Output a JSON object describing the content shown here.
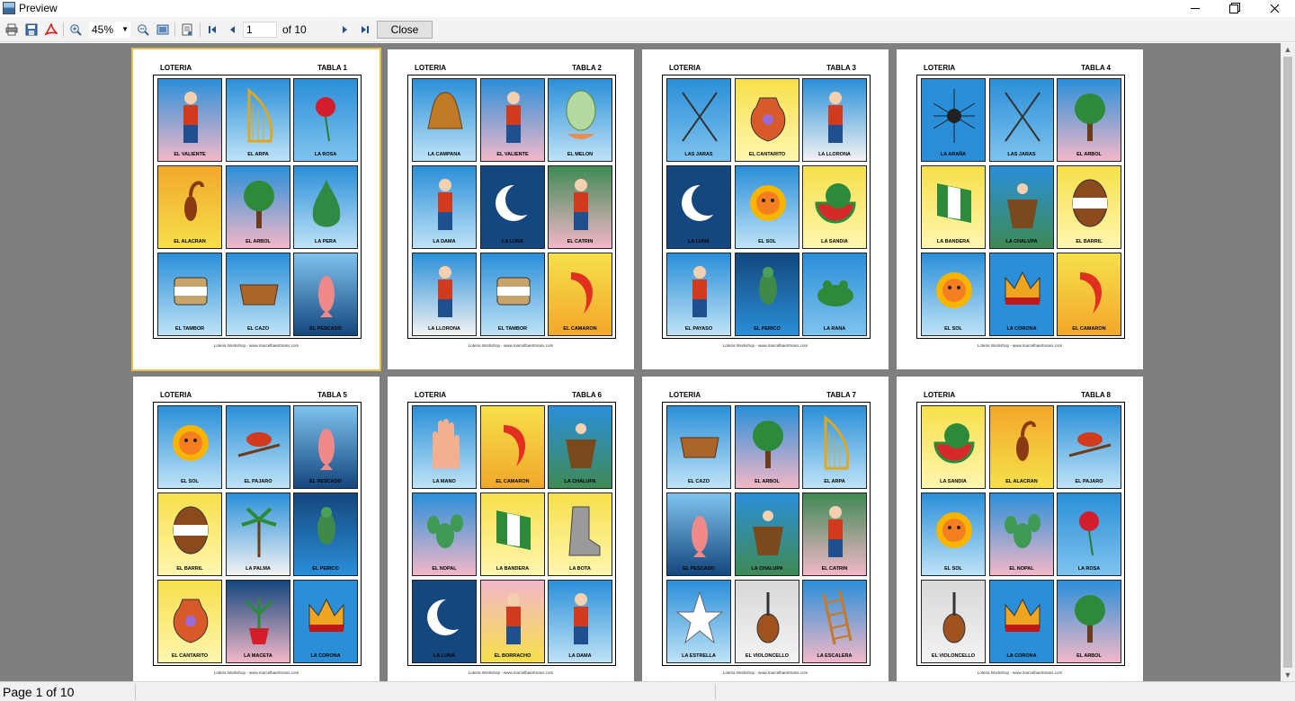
{
  "window": {
    "title": "Preview",
    "app_icon": "preview-app-icon"
  },
  "toolbar": {
    "icons": [
      "print-icon",
      "save-icon",
      "pdf-icon",
      "zoom-in-icon",
      "zoom-out-icon",
      "fit-page-icon",
      "page-setup-icon",
      "first-page-icon",
      "previous-page-icon",
      "next-page-icon",
      "last-page-icon"
    ],
    "zoom_value": "45%",
    "page_value": "1",
    "page_of": "of 10",
    "close_label": "Close"
  },
  "pages": [
    {
      "heading_left": "LOTERIA",
      "heading_right": "TABLA  1",
      "cards": [
        "EL VALIENTE",
        "EL ARPA",
        "LA ROSA",
        "EL ALACRAN",
        "EL ARBOL",
        "LA PERA",
        "EL TAMBOR",
        "EL CAZO",
        "EL PESCADO"
      ]
    },
    {
      "heading_left": "LOTERIA",
      "heading_right": "TABLA  2",
      "cards": [
        "LA CAMPANA",
        "EL VALIENTE",
        "EL MELON",
        "LA DAMA",
        "LA LUNA",
        "EL CATRIN",
        "LA LLORONA",
        "EL TAMBOR",
        "EL CAMARON"
      ]
    },
    {
      "heading_left": "LOTERIA",
      "heading_right": "TABLA  3",
      "cards": [
        "LAS JARAS",
        "EL CANTARITO",
        "LA LLORONA",
        "LA LUNA",
        "EL SOL",
        "LA SANDIA",
        "EL PAYASO",
        "EL PERICO",
        "LA RANA"
      ]
    },
    {
      "heading_left": "LOTERIA",
      "heading_right": "TABLA  4",
      "cards": [
        "LA ARAÑA",
        "LAS JARAS",
        "EL ARBOL",
        "LA BANDERA",
        "LA CHALUPA",
        "EL BARRIL",
        "EL SOL",
        "LA CORONA",
        "EL CAMARON"
      ]
    },
    {
      "heading_left": "LOTERIA",
      "heading_right": "TABLA  5",
      "cards": [
        "EL SOL",
        "EL PAJARO",
        "EL PESCADO",
        "EL BARRIL",
        "LA PALMA",
        "EL PERICO",
        "EL CANTARITO",
        "LA MACETA",
        "LA CORONA"
      ]
    },
    {
      "heading_left": "LOTERIA",
      "heading_right": "TABLA  6",
      "cards": [
        "LA MANO",
        "EL CAMARON",
        "LA CHALUPA",
        "EL NOPAL",
        "LA BANDERA",
        "LA BOTA",
        "LA LUNA",
        "EL BORRACHO",
        "LA DAMA"
      ]
    },
    {
      "heading_left": "LOTERIA",
      "heading_right": "TABLA  7",
      "cards": [
        "EL CAZO",
        "EL ARBOL",
        "EL ARPA",
        "EL PESCADO",
        "LA CHALUPA",
        "EL CATRIN",
        "LA ESTRELLA",
        "EL VIOLONCELLO",
        "LA ESCALERA"
      ]
    },
    {
      "heading_left": "LOTERIA",
      "heading_right": "TABLA  8",
      "cards": [
        "LA SANDIA",
        "EL ALACRAN",
        "EL PAJARO",
        "EL SOL",
        "EL NOPAL",
        "LA ROSA",
        "EL VIOLONCELLO",
        "LA CORONA",
        "EL ARBOL"
      ]
    }
  ],
  "footer_text": "Loteria Workshop - www.marcelbaertmans.com",
  "status": {
    "page_text": "Page 1 of 10"
  },
  "colors": {
    "viewport_bg": "#7f7f7f",
    "selected_page_border": "#e2c24a",
    "card_blue": "#2a8fd8",
    "card_yellow": "#f7e04a",
    "card_pink": "#f3b7c8",
    "card_navy": "#14477e",
    "card_green": "#3f8a55",
    "card_light": "#bfe3f7"
  }
}
